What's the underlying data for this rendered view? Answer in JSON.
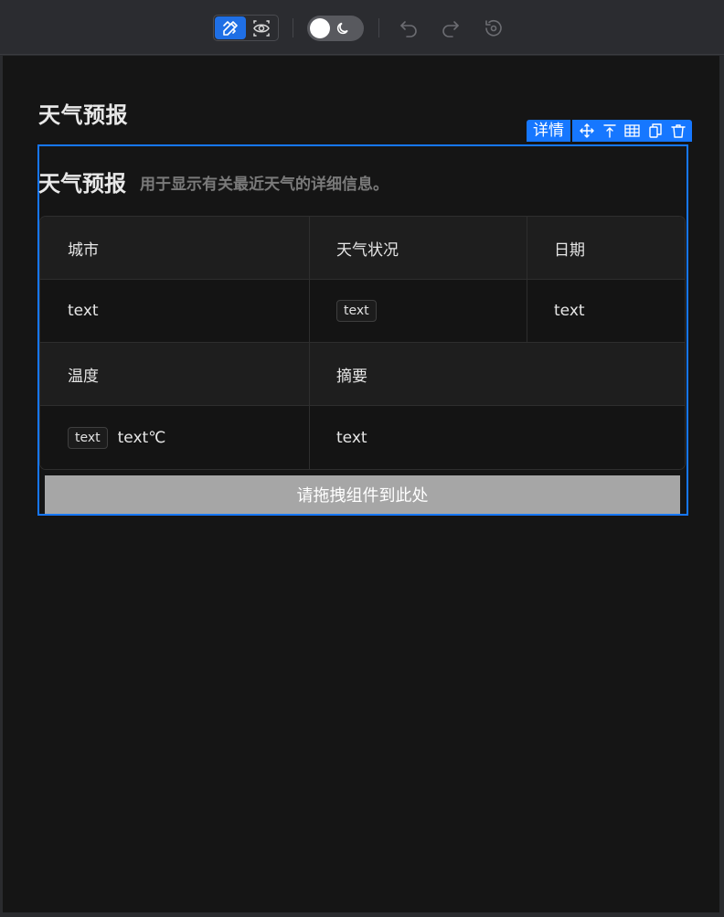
{
  "toolbar": {
    "modes": [
      {
        "icon": "design-pencil-ruler-icon",
        "active": true
      },
      {
        "icon": "preview-eye-icon",
        "active": false
      }
    ],
    "theme_toggle": {
      "icon": "moon-icon",
      "state": "on"
    },
    "history": [
      {
        "icon": "undo-icon",
        "enabled": false
      },
      {
        "icon": "redo-icon",
        "enabled": false
      },
      {
        "icon": "history-reset-icon",
        "enabled": false
      }
    ]
  },
  "page": {
    "title": "天气预报"
  },
  "selection": {
    "detail_label": "详情",
    "actions": [
      "move-icon",
      "move-to-top-icon",
      "table-icon",
      "copy-icon",
      "delete-icon"
    ],
    "accent_color": "#1677ff"
  },
  "card": {
    "title": "天气预报",
    "subtitle": "用于显示有关最近天气的详细信息。",
    "fields": {
      "city": {
        "label": "城市",
        "value": "text"
      },
      "condition": {
        "label": "天气状况",
        "value": "text"
      },
      "date": {
        "label": "日期",
        "value": "text"
      },
      "temperature": {
        "label": "温度",
        "tag": "text",
        "value": "text℃"
      },
      "summary": {
        "label": "摘要",
        "value": "text"
      }
    }
  },
  "dropzone": {
    "label": "请拖拽组件到此处"
  }
}
